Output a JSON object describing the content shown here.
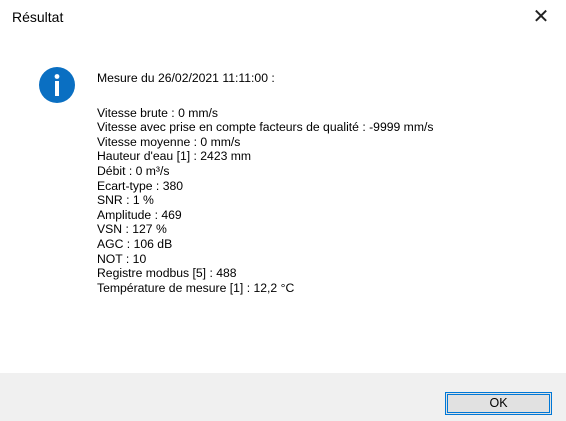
{
  "dialog": {
    "title": "Résultat",
    "close_glyph": "✕",
    "icon": "info-icon",
    "icon_color": "#0a6fc2",
    "header": "Mesure du 26/02/2021 11:11:00 :",
    "lines": [
      "Vitesse brute : 0 mm/s",
      "Vitesse avec prise en compte facteurs de qualité : -9999 mm/s",
      "Vitesse moyenne : 0 mm/s",
      "Hauteur d'eau [1] : 2423 mm",
      "Débit : 0 m³/s",
      "Ecart-type : 380",
      "SNR : 1 %",
      "Amplitude : 469",
      "VSN : 127 %",
      "AGC : 106 dB",
      "NOT : 10",
      "Registre modbus [5] : 488",
      "Température de mesure [1] : 12,2 °C"
    ],
    "ok_label": "OK",
    "footer_color": "#f0f0f0",
    "accent_color": "#0078d7"
  }
}
